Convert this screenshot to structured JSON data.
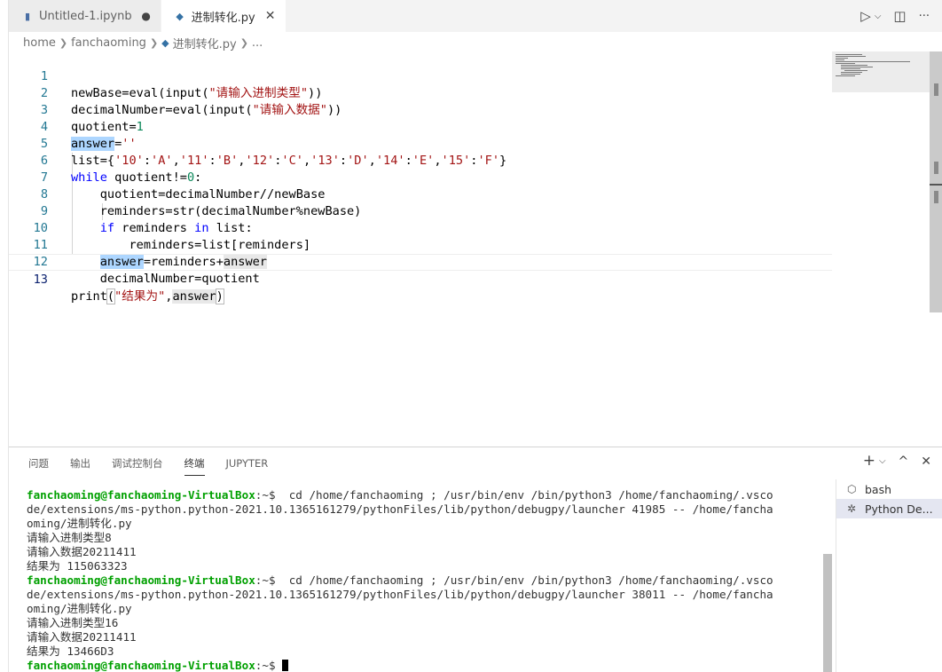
{
  "tabs": [
    {
      "icon": "notebook-icon",
      "label": "Untitled-1.ipynb",
      "marker": "●"
    },
    {
      "icon": "python-icon",
      "label": "进制转化.py",
      "marker": "✕"
    }
  ],
  "tab_actions": {
    "run": "▷",
    "chevron": "⌵",
    "split": "◫",
    "more": "···"
  },
  "breadcrumb": {
    "home": "home",
    "folder": "fanchaoming",
    "file": "进制转化.py",
    "ellipsis": "..."
  },
  "editor": {
    "line_numbers": [
      "1",
      "2",
      "3",
      "4",
      "5",
      "6",
      "7",
      "8",
      "9",
      "10",
      "11",
      "12",
      "13"
    ]
  },
  "panel": {
    "tabs": [
      "问题",
      "输出",
      "调试控制台",
      "终端",
      "JUPYTER"
    ],
    "actions": {
      "add": "+",
      "chevron": "⌵",
      "maximize": "^",
      "close": "✕"
    },
    "terminal": {
      "prompt": "fanchaoming@fanchaoming-VirtualBox",
      "prompt_suffix": ":~$ ",
      "run1_cmd": " cd /home/fanchaoming ; /usr/bin/env /bin/python3 /home/fanchaoming/.vsco",
      "run1_cmd2": "de/extensions/ms-python.python-2021.10.1365161279/pythonFiles/lib/python/debugpy/launcher 41985 -- /home/fancha",
      "run1_cmd3": "oming/进制转化.py",
      "run1_out1": "请输入进制类型8",
      "run1_out2": "请输入数据20211411",
      "run1_out3": "结果为 115063323",
      "run2_cmd": " cd /home/fanchaoming ; /usr/bin/env /bin/python3 /home/fanchaoming/.vsco",
      "run2_cmd2": "de/extensions/ms-python.python-2021.10.1365161279/pythonFiles/lib/python/debugpy/launcher 38011 -- /home/fancha",
      "run2_cmd3": "oming/进制转化.py",
      "run2_out1": "请输入进制类型16",
      "run2_out2": "请输入数据20211411",
      "run2_out3": "结果为 13466D3"
    },
    "terminal_list": [
      {
        "icon": "bash-icon",
        "label": "bash"
      },
      {
        "icon": "debug-icon",
        "label": "Python De..."
      }
    ]
  }
}
